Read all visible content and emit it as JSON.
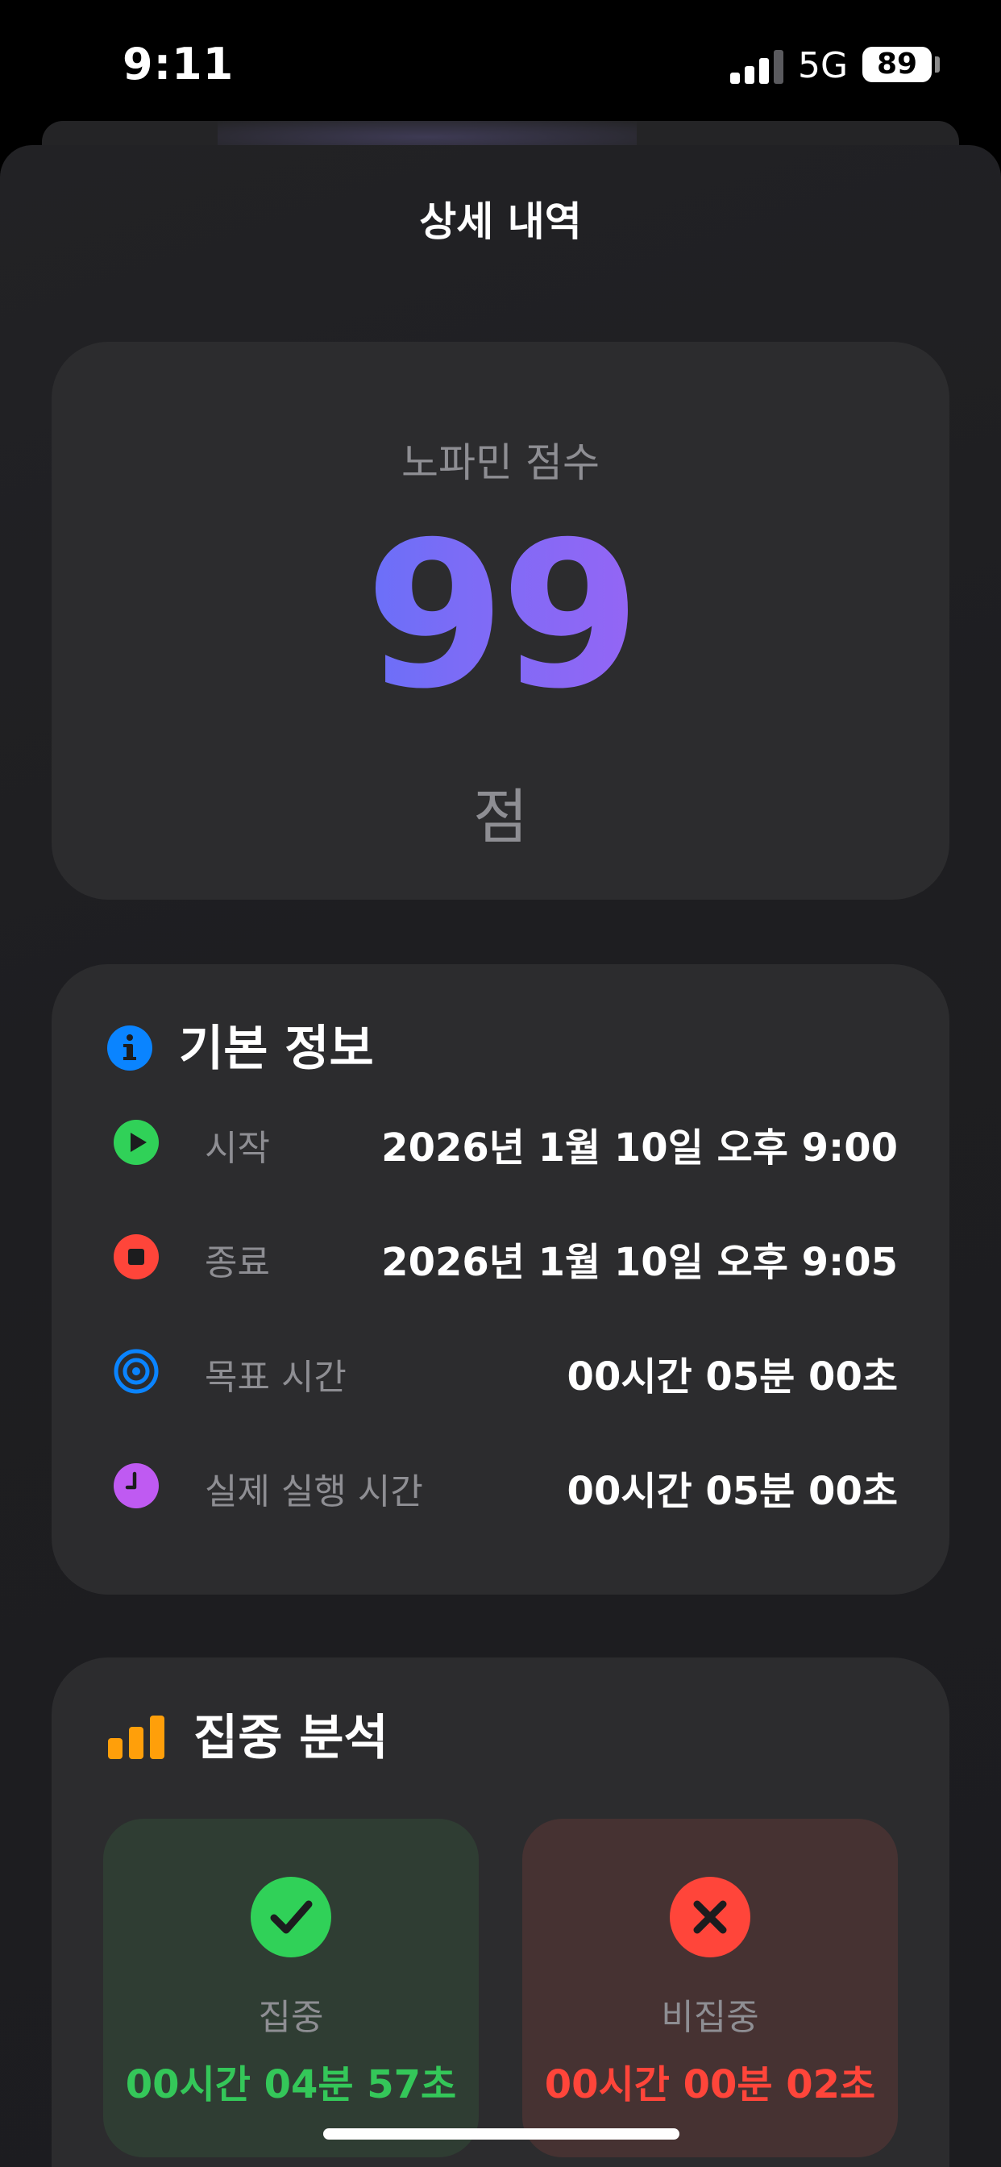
{
  "status_bar": {
    "time": "9:11",
    "network": "5G",
    "battery": "89",
    "signal_bars_active": 3,
    "signal_bars_total": 4
  },
  "header": {
    "title": "상세 내역"
  },
  "score": {
    "label": "노파민 점수",
    "value": "99",
    "unit": "점",
    "gradient_colors": [
      "#2f7cff",
      "#bf5af2"
    ]
  },
  "basic_info": {
    "title": "기본 정보",
    "icon": "info-icon",
    "icon_color": "#0a84ff",
    "rows": [
      {
        "label": "시작",
        "value": "2026년 1월 10일 오후 9:00",
        "icon": "play-icon",
        "color": "#30d158"
      },
      {
        "label": "종료",
        "value": "2026년 1월 10일 오후 9:05",
        "icon": "stop-icon",
        "color": "#ff453a"
      },
      {
        "label": "목표 시간",
        "value": "00시간 05분 00초",
        "icon": "target-icon",
        "color": "#0a84ff"
      },
      {
        "label": "실제 실행 시간",
        "value": "00시간 05분 00초",
        "icon": "clock-icon",
        "color": "#bf5af2"
      }
    ]
  },
  "focus_analysis": {
    "title": "집중 분석",
    "icon": "bar-chart-icon",
    "icon_color": "#ff9f0a",
    "focus": {
      "label": "집중",
      "value": "00시간 04분 57초",
      "icon": "checkmark-icon",
      "color": "#30d158"
    },
    "nonfocus": {
      "label": "비집중",
      "value": "00시간 00분 02초",
      "icon": "x-mark-icon",
      "color": "#ff453a"
    }
  }
}
